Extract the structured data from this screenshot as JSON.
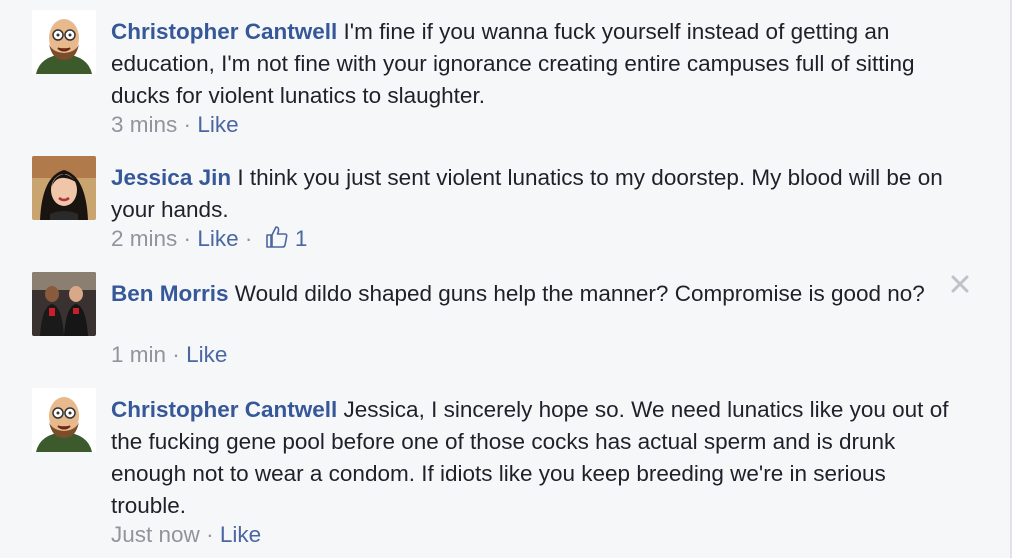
{
  "comments": [
    {
      "author": "Christopher Cantwell",
      "text": "I'm fine if you wanna fuck yourself instead of getting an education, I'm not fine with your ignorance creating entire campuses full of sitting ducks for violent lunatics to slaughter.",
      "time": "3 mins",
      "like_label": "Like"
    },
    {
      "author": "Jessica Jin",
      "text": "I think you just sent violent lunatics to my doorstep. My blood will be on your hands.",
      "time": "2 mins",
      "like_label": "Like",
      "like_count": "1"
    },
    {
      "author": "Ben Morris",
      "text": "Would dildo shaped guns help the manner? Compromise is good no?",
      "time": "1 min",
      "like_label": "Like"
    },
    {
      "author": "Christopher Cantwell",
      "text": "Jessica, I sincerely hope so. We need lunatics like you out of the fucking gene pool before one of those cocks has actual sperm and is drunk enough not to wear a condom. If idiots like you keep breeding we're in serious trouble.",
      "time": "Just now",
      "like_label": "Like"
    }
  ],
  "separator": "·",
  "colors": {
    "author": "#365899",
    "link": "#4b67a1",
    "meta": "#90949c",
    "body": "#1d2129",
    "background": "#f6f7f9"
  },
  "icons": {
    "like_count_icon": "thumbs-up-icon",
    "hide_icon": "close-icon"
  }
}
